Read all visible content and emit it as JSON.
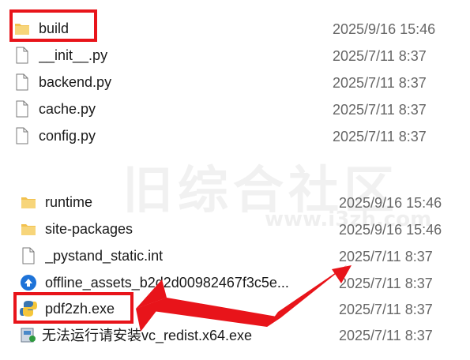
{
  "watermark": {
    "text": "旧综合社区",
    "url": "www.i3zh.com"
  },
  "group1": [
    {
      "name": "build",
      "date": "2025/9/16 15:46",
      "icon": "folder-icon"
    },
    {
      "name": "__init__.py",
      "date": "2025/7/11 8:37",
      "icon": "file-icon"
    },
    {
      "name": "backend.py",
      "date": "2025/7/11 8:37",
      "icon": "file-icon"
    },
    {
      "name": "cache.py",
      "date": "2025/7/11 8:37",
      "icon": "file-icon"
    },
    {
      "name": "config.py",
      "date": "2025/7/11 8:37",
      "icon": "file-icon"
    }
  ],
  "group2": [
    {
      "name": "runtime",
      "date": "2025/9/16 15:46",
      "icon": "folder-icon"
    },
    {
      "name": "site-packages",
      "date": "2025/9/16 15:46",
      "icon": "folder-icon"
    },
    {
      "name": "_pystand_static.int",
      "date": "2025/7/11 8:37",
      "icon": "file-icon"
    },
    {
      "name": "offline_assets_b2d2d00982467f3c5e...",
      "date": "2025/7/11 8:37",
      "icon": "zip-icon"
    },
    {
      "name": "pdf2zh.exe",
      "date": "2025/7/11 8:37",
      "icon": "python-icon"
    },
    {
      "name": "无法运行请安装vc_redist.x64.exe",
      "date": "2025/7/11 8:37",
      "icon": "installer-icon"
    }
  ],
  "colors": {
    "highlight": "#e8141a",
    "folder": "#f2c14e",
    "date_text": "#666666"
  }
}
